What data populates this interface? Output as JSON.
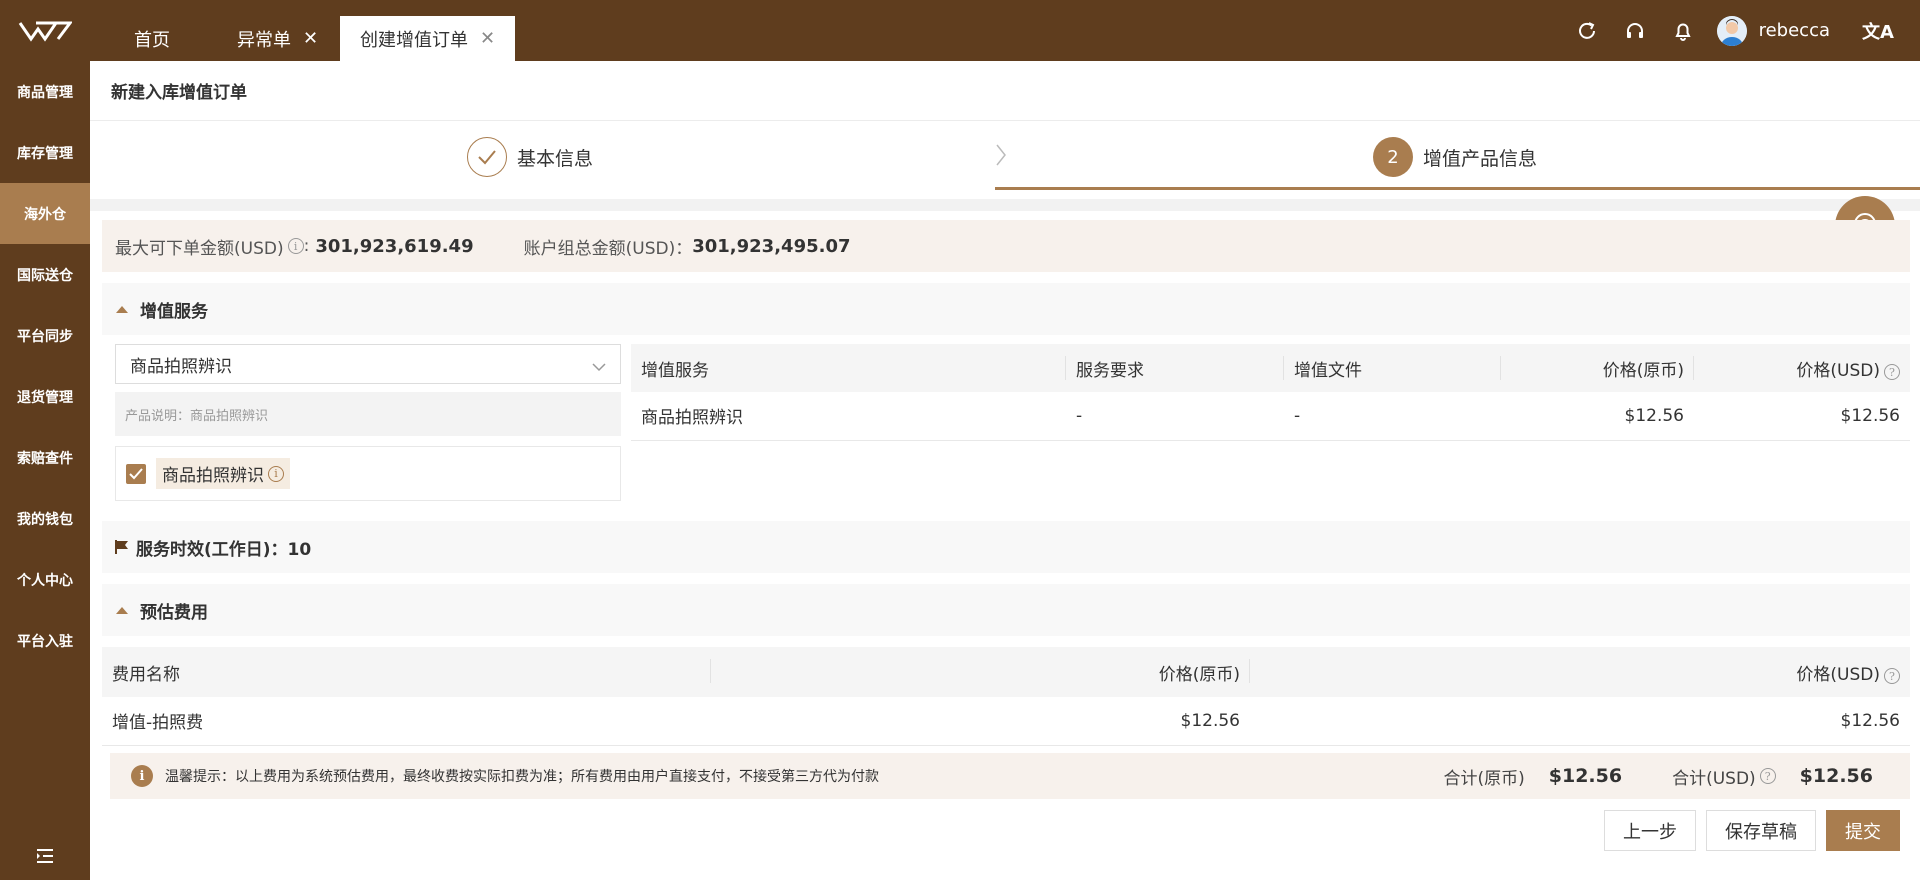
{
  "header": {
    "tabs": [
      {
        "label": "首页"
      },
      {
        "label": "异常单"
      },
      {
        "label": "创建增值订单"
      }
    ],
    "user": {
      "name": "rebecca"
    }
  },
  "sidebar": {
    "items": [
      {
        "label": "商品管理"
      },
      {
        "label": "库存管理"
      },
      {
        "label": "海外仓"
      },
      {
        "label": "国际送仓"
      },
      {
        "label": "平台同步"
      },
      {
        "label": "退货管理"
      },
      {
        "label": "索赔查件"
      },
      {
        "label": "我的钱包"
      },
      {
        "label": "个人中心"
      },
      {
        "label": "平台入驻"
      }
    ]
  },
  "page": {
    "title": "新建入库增值订单",
    "steps": [
      {
        "label": "基本信息"
      },
      {
        "label": "增值产品信息",
        "number": "2"
      }
    ]
  },
  "amounts": {
    "max_label": "最大可下单金额(USD)",
    "colon1": ":",
    "max_value": "301,923,619.49",
    "total_label": "账户组总金额(USD)：",
    "total_value": "301,923,495.07"
  },
  "value_added": {
    "section_title": "增值服务",
    "select_value": "商品拍照辨识",
    "product_desc": "产品说明：商品拍照辨识",
    "checkbox_label": "商品拍照辨识",
    "table": {
      "headers": [
        "增值服务",
        "服务要求",
        "增值文件",
        "价格(原币)",
        "价格(USD)"
      ],
      "rows": [
        [
          "商品拍照辨识",
          "-",
          "-",
          "$12.56",
          "$12.56"
        ]
      ]
    }
  },
  "service_time": {
    "label": "服务时效(工作日)：10"
  },
  "fees": {
    "section_title": "预估费用",
    "table": {
      "headers": [
        "费用名称",
        "价格(原币)",
        "价格(USD)"
      ],
      "rows": [
        [
          "增值-拍照费",
          "$12.56",
          "$12.56"
        ]
      ]
    },
    "tip": "温馨提示：以上费用为系统预估费用，最终收费按实际扣费为准；所有费用由用户直接支付，不接受第三方代为付款",
    "total_orig_label": "合计(原币)",
    "total_orig_value": "$12.56",
    "total_usd_label": "合计(USD)",
    "total_usd_value": "$12.56"
  },
  "buttons": {
    "prev": "上一步",
    "save": "保存草稿",
    "submit": "提交"
  },
  "colors": {
    "brand_dark": "#5f3d1e",
    "brand_accent": "#a97d4f"
  }
}
